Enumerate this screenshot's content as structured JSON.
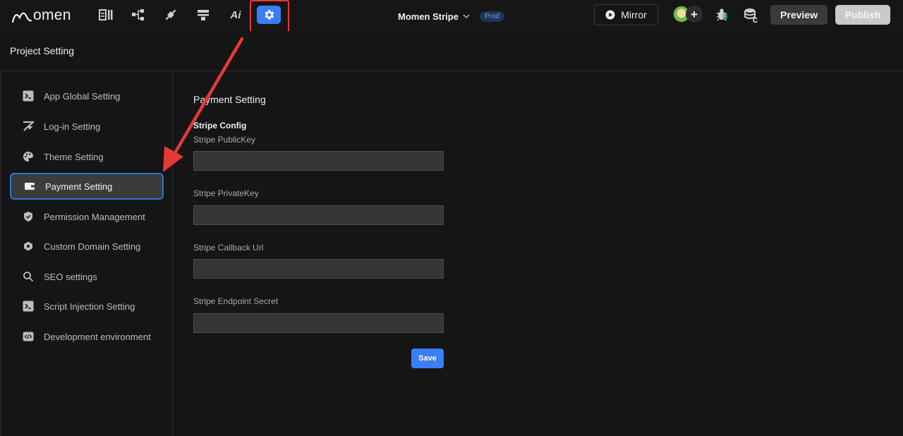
{
  "topbar": {
    "logo_text": "omen",
    "nav_icons": [
      "layout-icon",
      "flow-icon",
      "actions-icon",
      "data-icon",
      "ai-icon",
      "settings-icon"
    ],
    "nav_ai_label": "Ai",
    "project_name": "Momen Stripe",
    "env_badge": "Prod",
    "mirror_label": "Mirror",
    "bug_count": "0",
    "db_letter": "C",
    "preview_label": "Preview",
    "publish_label": "Publish"
  },
  "header": {
    "title": "Project Setting"
  },
  "sidebar": {
    "items": [
      {
        "label": "App Global Setting",
        "icon": "terminal-icon"
      },
      {
        "label": "Log-in Setting",
        "icon": "login-icon"
      },
      {
        "label": "Theme Setting",
        "icon": "palette-icon"
      },
      {
        "label": "Payment Setting",
        "icon": "wallet-icon"
      },
      {
        "label": "Permission Management",
        "icon": "shield-icon"
      },
      {
        "label": "Custom Domain Setting",
        "icon": "hexagon-icon"
      },
      {
        "label": "SEO settings",
        "icon": "search-icon"
      },
      {
        "label": "Script Injection Setting",
        "icon": "terminal-icon"
      },
      {
        "label": "Development environment",
        "icon": "code-icon"
      }
    ],
    "active_index": 3
  },
  "main": {
    "section_title": "Payment Setting",
    "group_title": "Stripe Config",
    "fields": [
      {
        "label": "Stripe PublicKey",
        "value": ""
      },
      {
        "label": "Stripe PrivateKey",
        "value": ""
      },
      {
        "label": "Stripe Callback Url",
        "value": ""
      },
      {
        "label": "Stripe Endpoint Secret",
        "value": ""
      }
    ],
    "save_label": "Save"
  },
  "colors": {
    "accent": "#3a7ef6",
    "annotation": "#e53935",
    "background": "#151515"
  }
}
